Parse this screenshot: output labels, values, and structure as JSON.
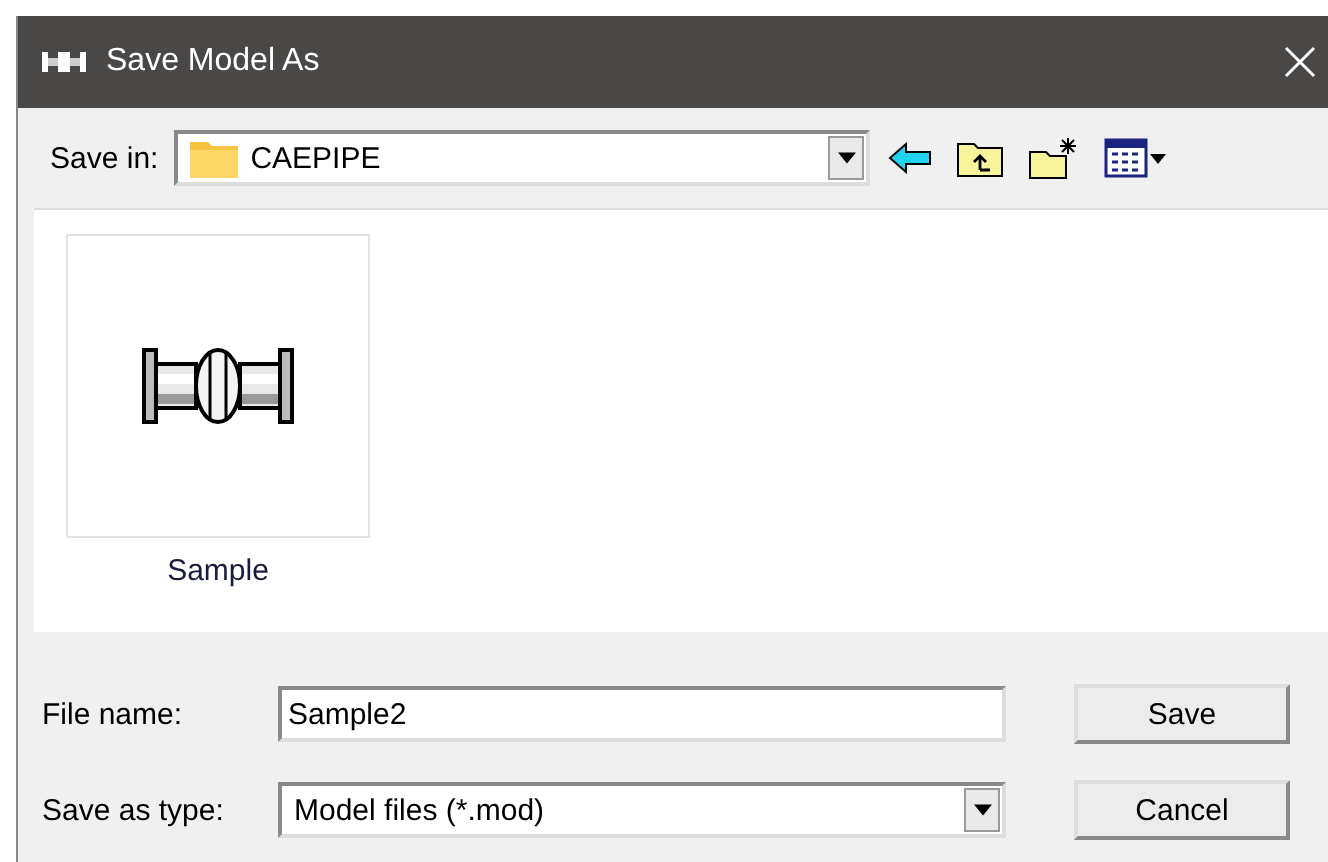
{
  "window": {
    "title": "Save Model As"
  },
  "save_in": {
    "label": "Save in:",
    "value": "CAEPIPE"
  },
  "files": [
    {
      "name": "Sample"
    }
  ],
  "file_name": {
    "label": "File name:",
    "value": "Sample2"
  },
  "save_as_type": {
    "label": "Save as type:",
    "value": "Model files (*.mod)"
  },
  "buttons": [
    "Save",
    "Cancel"
  ]
}
